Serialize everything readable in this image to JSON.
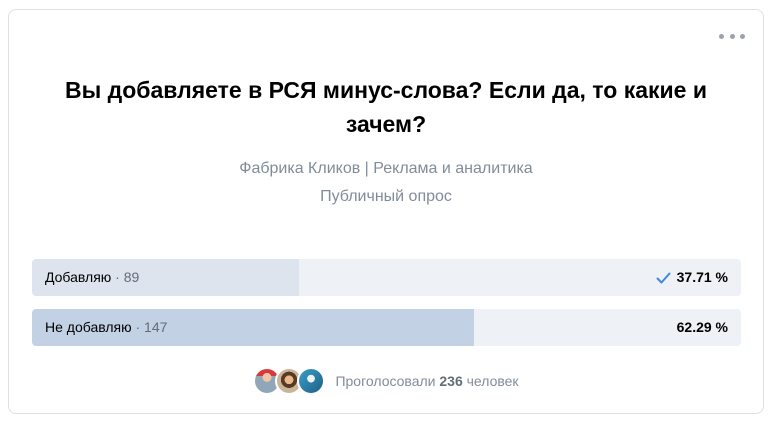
{
  "poll": {
    "title": "Вы добавляете в РСЯ минус-слова? Если да, то какие и зачем?",
    "author": "Фабрика Кликов | Реклама и аналитика",
    "kind": "Публичный опрос",
    "options": [
      {
        "label": "Добавляю",
        "count_text": " · 89",
        "count": 89,
        "percent": 37.71,
        "percent_text": "37.71 %",
        "voted_by_me": true,
        "fill_color": "#dde4ee"
      },
      {
        "label": "Не добавляю",
        "count_text": " · 147",
        "count": 147,
        "percent": 62.29,
        "percent_text": "62.29 %",
        "voted_by_me": false,
        "fill_color": "#c2d1e4"
      }
    ],
    "voters": {
      "prefix": "Проголосовали ",
      "total": "236",
      "suffix": " человек",
      "avatars": [
        "avatar-1",
        "avatar-2",
        "avatar-3"
      ]
    },
    "colors": {
      "accent": "#3f8ae0",
      "muted": "#818c99",
      "track": "#eef1f5"
    },
    "icons": {
      "menu": "more-horizontal-icon",
      "check": "check-icon"
    }
  }
}
